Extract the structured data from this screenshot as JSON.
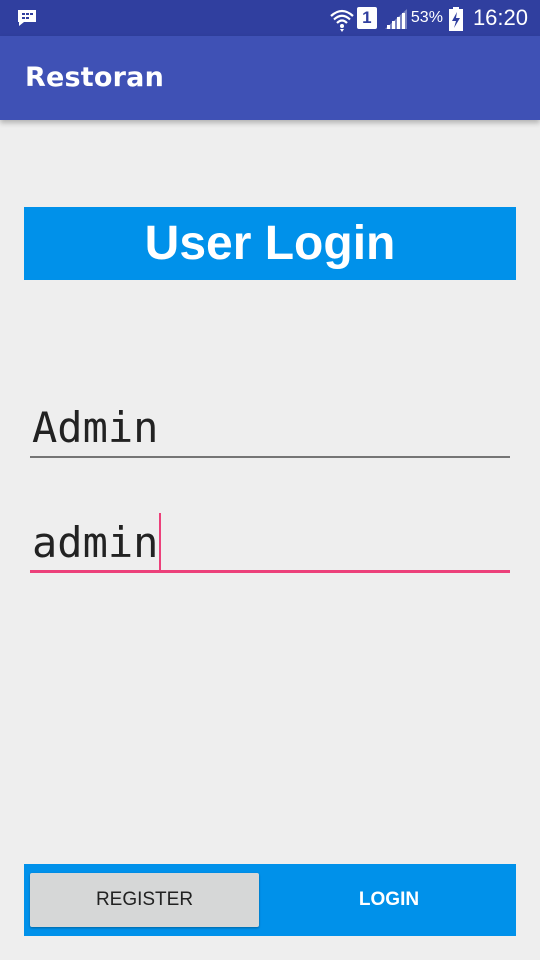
{
  "status_bar": {
    "left_icon": "bbm-chat-icon",
    "battery_percent": "53%",
    "time": "16:20",
    "sim_label": "1",
    "icons": [
      "wifi-icon",
      "sim-icon",
      "signal-icon",
      "battery-charging-icon"
    ]
  },
  "app_bar": {
    "title": "Restoran",
    "color": "#3f51b5"
  },
  "login": {
    "banner_title": "User Login",
    "banner_color": "#0091ea",
    "username_value": "Admin",
    "password_value": "admin",
    "focus_color": "#ec407a"
  },
  "buttons": {
    "register_label": "REGISTER",
    "login_label": "LOGIN"
  }
}
